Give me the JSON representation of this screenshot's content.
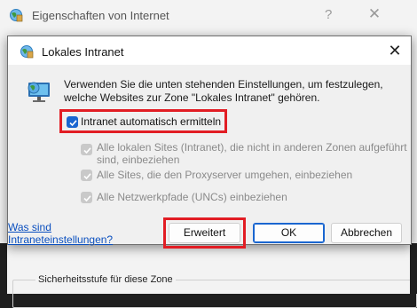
{
  "parent": {
    "title": "Eigenschaften von Internet",
    "help_glyph": "?",
    "close_glyph": "✕",
    "group_label": "Sicherheitsstufe für diese Zone"
  },
  "dialog": {
    "title": "Lokales Intranet",
    "close_glyph": "✕",
    "info_text": "Verwenden Sie die unten stehenden Einstellungen, um festzulegen, welche Websites zur Zone \"Lokales Intranet\" gehören.",
    "checkboxes": [
      {
        "label": "Intranet automatisch ermitteln",
        "checked": true,
        "enabled": true
      },
      {
        "label": "Alle lokalen Sites (Intranet), die nicht in anderen Zonen aufgeführt sind, einbeziehen",
        "checked": true,
        "enabled": false
      },
      {
        "label": "Alle Sites, die den Proxyserver umgehen, einbeziehen",
        "checked": true,
        "enabled": false
      },
      {
        "label": "Alle Netzwerkpfade (UNCs) einbeziehen",
        "checked": true,
        "enabled": false
      }
    ],
    "help_link": "Was sind Intraneteinstellungen?",
    "buttons": {
      "advanced": "Erweitert",
      "ok": "OK",
      "cancel": "Abbrechen"
    }
  },
  "colors": {
    "highlight": "#e21d24",
    "accent": "#1a66d0",
    "link": "#0a4fbf"
  }
}
